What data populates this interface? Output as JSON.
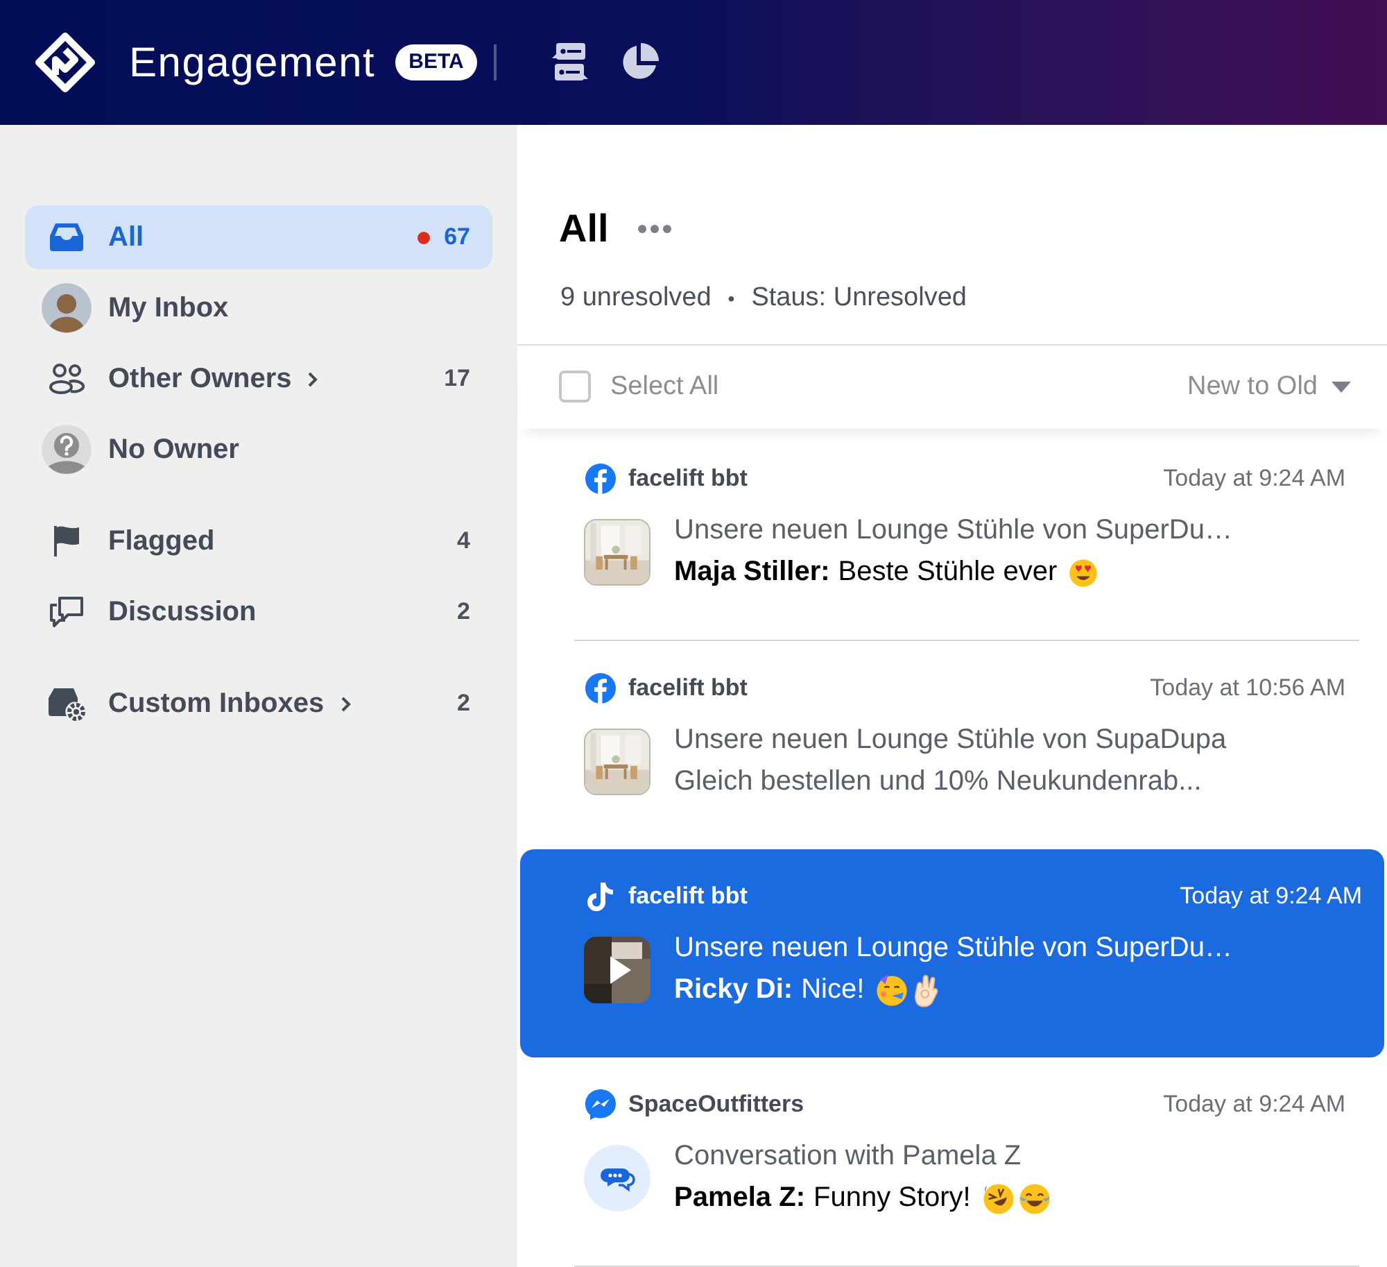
{
  "header": {
    "title": "Engagement",
    "badge": "BETA"
  },
  "sidebar": {
    "groups": [
      [
        {
          "kind": "inbox",
          "label": "All",
          "count": "67",
          "unread": true,
          "has_submenu": false,
          "selected": true
        },
        {
          "kind": "avatar",
          "label": "My Inbox",
          "unread": false,
          "has_submenu": false,
          "selected": false
        },
        {
          "kind": "people",
          "label": "Other Owners",
          "count": "17",
          "unread": false,
          "has_submenu": true,
          "selected": false
        },
        {
          "kind": "unknown",
          "label": "No Owner",
          "unread": false,
          "has_submenu": false,
          "selected": false
        }
      ],
      [
        {
          "kind": "flag",
          "label": "Flagged",
          "count": "4",
          "unread": false,
          "has_submenu": false,
          "selected": false
        },
        {
          "kind": "discussion",
          "label": "Discussion",
          "count": "2",
          "unread": false,
          "has_submenu": false,
          "selected": false
        }
      ],
      [
        {
          "kind": "custom",
          "label": "Custom Inboxes",
          "count": "2",
          "unread": false,
          "has_submenu": true,
          "selected": false
        }
      ]
    ]
  },
  "main": {
    "title": "All",
    "summary": "9 unresolved",
    "separator": "•",
    "status": "Staus: Unresolved",
    "select_all": {
      "label": "Select All",
      "checked": false
    },
    "sort": "New to Old",
    "conversations": [
      {
        "channel": {
          "kind": "facebook"
        },
        "account": "facelift bbt",
        "time": "Today at 9:24 AM",
        "thumbnail": {
          "kind": "room"
        },
        "subject": "Unsere neuen Lounge Stühle von SuperDu…",
        "author": "Maja Stiller:",
        "message": "Beste Stühle ever",
        "emoji": [
          {
            "kind": "heart_eyes"
          }
        ],
        "selected": false
      },
      {
        "channel": {
          "kind": "facebook"
        },
        "account": "facelift bbt",
        "time": "Today at 10:56 AM",
        "thumbnail": {
          "kind": "room"
        },
        "subject": "Unsere neuen Lounge Stühle von SupaDupa",
        "preview": "Gleich bestellen und 10% Neukundenrab...",
        "selected": false
      },
      {
        "channel": {
          "kind": "tiktok"
        },
        "account": "facelift bbt",
        "time": "Today at 9:24 AM",
        "thumbnail": {
          "kind": "video"
        },
        "subject": "Unsere neuen Lounge Stühle von SuperDu…",
        "author": "Ricky Di:",
        "message": "Nice!",
        "emoji": [
          {
            "kind": "party"
          },
          {
            "kind": "ok_hand"
          }
        ],
        "selected": true
      },
      {
        "channel": {
          "kind": "messenger"
        },
        "account": "SpaceOutfitters",
        "time": "Today at 9:24 AM",
        "thumbnail": {
          "kind": "chat"
        },
        "subject": "Conversation with Pamela Z",
        "author": "Pamela Z:",
        "message": "Funny Story!",
        "emoji": [
          {
            "kind": "rofl"
          },
          {
            "kind": "joy"
          }
        ],
        "selected": false
      }
    ]
  }
}
